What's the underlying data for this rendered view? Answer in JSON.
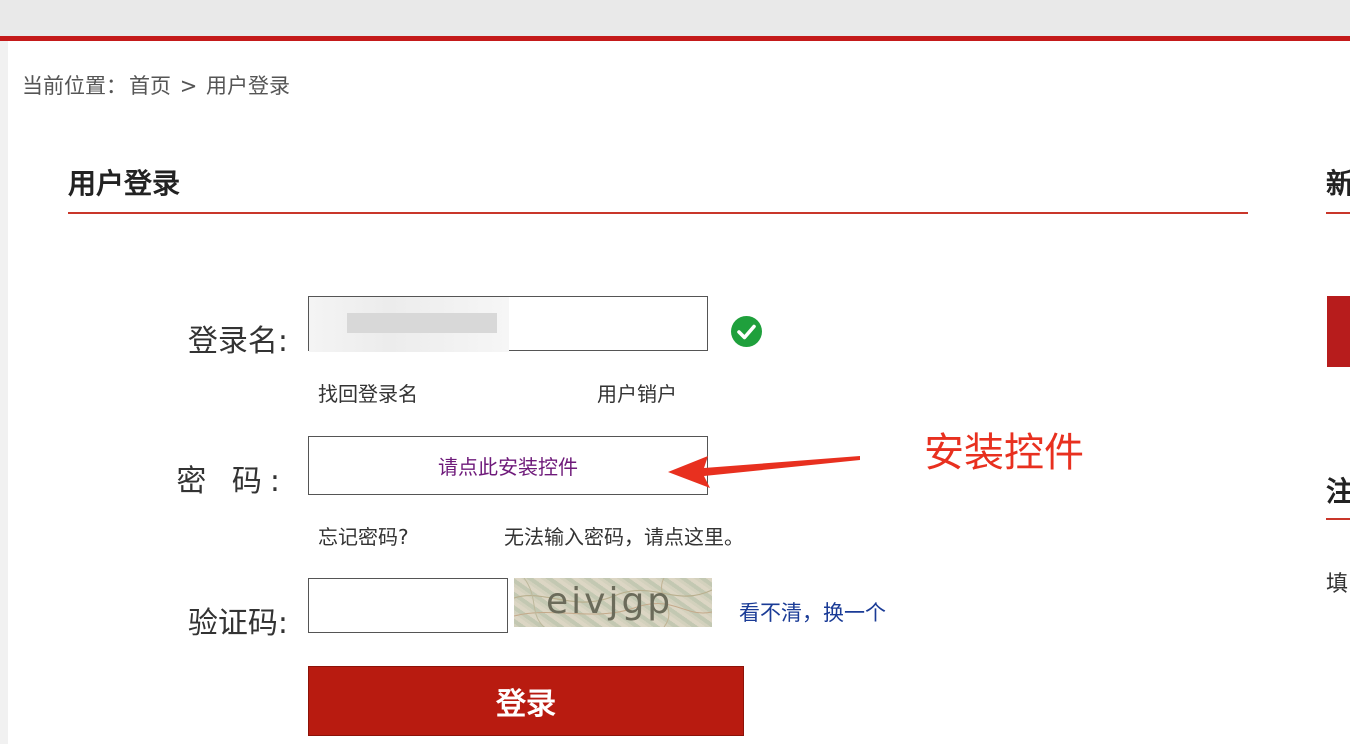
{
  "breadcrumb": {
    "prefix": "当前位置：",
    "home": "首页",
    "separator": ">",
    "current": "用户登录"
  },
  "login": {
    "title": "用户登录",
    "username_label": "登录名:",
    "username_value": "",
    "find_username_link": "找回登录名",
    "cancel_account_link": "用户销户",
    "password_label": "密 码:",
    "password_install_link": "请点此安装控件",
    "forgot_password_link": "忘记密码?",
    "cant_input_link": "无法输入密码，请点这里。",
    "captcha_label": "验证码:",
    "captcha_value": "",
    "captcha_image_text": "eivjgp",
    "refresh_captcha_link": "看不清，换一个",
    "submit_label": "登录"
  },
  "sidebar": {
    "title1": "新",
    "title2": "注",
    "text": "填"
  },
  "annotation": {
    "text": "安装控件",
    "color": "#e8301f"
  },
  "colors": {
    "brand_red": "#b81b10",
    "link_blue": "#1a3b96",
    "success_green": "#1fa03c"
  }
}
